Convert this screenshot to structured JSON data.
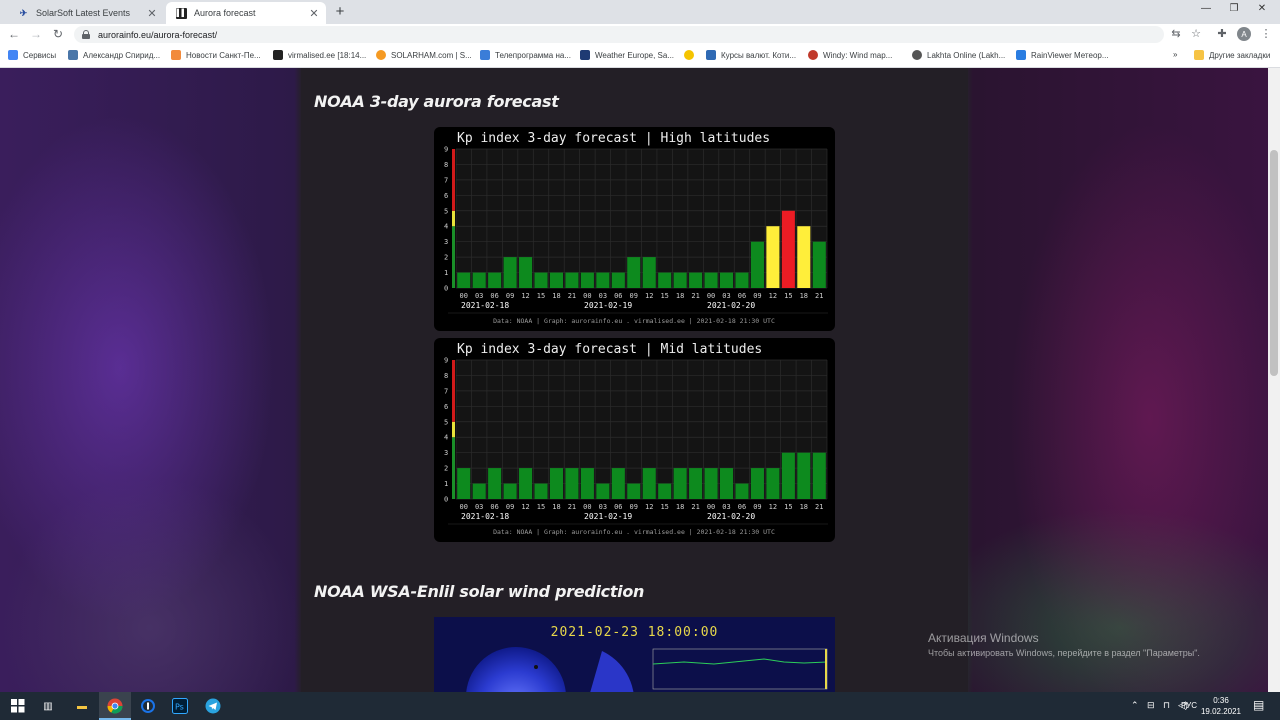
{
  "browser": {
    "tabs": [
      {
        "title": "SolarSoft Latest Events",
        "active": false
      },
      {
        "title": "Aurora forecast",
        "active": true
      }
    ],
    "url": "aurorainfo.eu/aurora-forecast/",
    "profile_initial": "A",
    "bookmarks": [
      {
        "label": "Сервисы",
        "icon": "apps-grid-icon",
        "color": "#4285f4"
      },
      {
        "label": "Александр Спирид...",
        "icon": "vk-icon",
        "color": "#4a76a8"
      },
      {
        "label": "Новости Санкт-Пе...",
        "icon": "news-icon",
        "color": "#f28b3c"
      },
      {
        "label": "virmalised.ee [18:14...",
        "icon": "virmalised-icon",
        "color": "#222222"
      },
      {
        "label": "SOLARHAM.com | S...",
        "icon": "solarham-icon",
        "color": "#f59a23"
      },
      {
        "label": "Телепрограмма на...",
        "icon": "tv-icon",
        "color": "#3b7dd8"
      },
      {
        "label": "Weather Europe, Sa...",
        "icon": "weather-icon",
        "color": "#1f3b73"
      },
      {
        "label": "",
        "icon": "sun-icon",
        "color": "#f5c400"
      },
      {
        "label": "Курсы валют. Коти...",
        "icon": "rbc-icon",
        "color": "#2f6ab4"
      },
      {
        "label": "Windy: Wind map...",
        "icon": "windy-icon",
        "color": "#c0392b"
      },
      {
        "label": "Lakhta Online (Lakh...",
        "icon": "globe-icon",
        "color": "#555555"
      },
      {
        "label": "RainViewer Метеор...",
        "icon": "rainviewer-icon",
        "color": "#2a7de1"
      }
    ],
    "other_bookmarks": "Другие закладки"
  },
  "sections": {
    "aurora_title": "NOAA 3-day aurora forecast",
    "wsa_title": "NOAA WSA-Enlil solar wind prediction",
    "wsa_date": "2021-02-23 18:00:00"
  },
  "chart_data": [
    {
      "type": "bar",
      "title": "Kp index 3-day forecast | High latitudes",
      "categories": [
        "00",
        "03",
        "06",
        "09",
        "12",
        "15",
        "18",
        "21",
        "00",
        "03",
        "06",
        "09",
        "12",
        "15",
        "18",
        "21",
        "00",
        "03",
        "06",
        "09",
        "12",
        "15",
        "18",
        "21"
      ],
      "dates": [
        "2021-02-18",
        "2021-02-19",
        "2021-02-20"
      ],
      "values": [
        1,
        1,
        1,
        2,
        2,
        1,
        1,
        1,
        1,
        1,
        1,
        2,
        2,
        1,
        1,
        1,
        1,
        1,
        1,
        3,
        4,
        5,
        4,
        3
      ],
      "ylim": [
        0,
        9
      ],
      "yticks": [
        0,
        1,
        2,
        3,
        4,
        5,
        6,
        7,
        8,
        9
      ],
      "grid": true,
      "footer": "Data: NOAA | Graph: aurorainfo.eu . virmalised.ee | 2021-02-18 21:30 UTC"
    },
    {
      "type": "bar",
      "title": "Kp index 3-day forecast | Mid latitudes",
      "categories": [
        "00",
        "03",
        "06",
        "09",
        "12",
        "15",
        "18",
        "21",
        "00",
        "03",
        "06",
        "09",
        "12",
        "15",
        "18",
        "21",
        "00",
        "03",
        "06",
        "09",
        "12",
        "15",
        "18",
        "21"
      ],
      "dates": [
        "2021-02-18",
        "2021-02-19",
        "2021-02-20"
      ],
      "values": [
        2,
        1,
        2,
        1,
        2,
        1,
        2,
        2,
        2,
        1,
        2,
        1,
        2,
        1,
        2,
        2,
        2,
        2,
        1,
        2,
        2,
        3,
        3,
        3
      ],
      "ylim": [
        0,
        9
      ],
      "yticks": [
        0,
        1,
        2,
        3,
        4,
        5,
        6,
        7,
        8,
        9
      ],
      "grid": true,
      "footer": "Data: NOAA | Graph: aurorainfo.eu . virmalised.ee | 2021-02-18 21:30 UTC"
    }
  ],
  "colors": {
    "bar_green": "#0d8a1e",
    "bar_yellow": "#ffee3a",
    "bar_red": "#ec1c24",
    "axis_green": "#1a8f28",
    "axis_yellow": "#e8e23a",
    "axis_red": "#d11a1a"
  },
  "watermark": {
    "line1": "Активация Windows",
    "line2": "Чтобы активировать Windows, перейдите в раздел \"Параметры\"."
  },
  "taskbar": {
    "lang": "РУС",
    "time": "0:36",
    "date": "19.02.2021"
  }
}
